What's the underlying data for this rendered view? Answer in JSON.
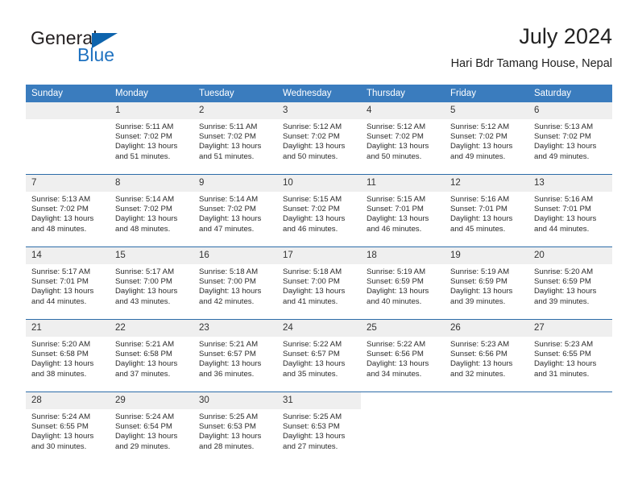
{
  "logo": {
    "word_one": "General",
    "word_two": "Blue",
    "icon": "triangle-logo-icon"
  },
  "header": {
    "title": "July 2024",
    "subtitle": "Hari Bdr Tamang House, Nepal"
  },
  "calendar": {
    "weekdays": [
      "Sunday",
      "Monday",
      "Tuesday",
      "Wednesday",
      "Thursday",
      "Friday",
      "Saturday"
    ],
    "header_bg": "#3a7cbe",
    "daynum_bg": "#efefef",
    "row_divider": "#2d6ca8",
    "weeks": [
      [
        {
          "day": "",
          "lines": []
        },
        {
          "day": "1",
          "lines": [
            "Sunrise: 5:11 AM",
            "Sunset: 7:02 PM",
            "Daylight: 13 hours",
            "and 51 minutes."
          ]
        },
        {
          "day": "2",
          "lines": [
            "Sunrise: 5:11 AM",
            "Sunset: 7:02 PM",
            "Daylight: 13 hours",
            "and 51 minutes."
          ]
        },
        {
          "day": "3",
          "lines": [
            "Sunrise: 5:12 AM",
            "Sunset: 7:02 PM",
            "Daylight: 13 hours",
            "and 50 minutes."
          ]
        },
        {
          "day": "4",
          "lines": [
            "Sunrise: 5:12 AM",
            "Sunset: 7:02 PM",
            "Daylight: 13 hours",
            "and 50 minutes."
          ]
        },
        {
          "day": "5",
          "lines": [
            "Sunrise: 5:12 AM",
            "Sunset: 7:02 PM",
            "Daylight: 13 hours",
            "and 49 minutes."
          ]
        },
        {
          "day": "6",
          "lines": [
            "Sunrise: 5:13 AM",
            "Sunset: 7:02 PM",
            "Daylight: 13 hours",
            "and 49 minutes."
          ]
        }
      ],
      [
        {
          "day": "7",
          "lines": [
            "Sunrise: 5:13 AM",
            "Sunset: 7:02 PM",
            "Daylight: 13 hours",
            "and 48 minutes."
          ]
        },
        {
          "day": "8",
          "lines": [
            "Sunrise: 5:14 AM",
            "Sunset: 7:02 PM",
            "Daylight: 13 hours",
            "and 48 minutes."
          ]
        },
        {
          "day": "9",
          "lines": [
            "Sunrise: 5:14 AM",
            "Sunset: 7:02 PM",
            "Daylight: 13 hours",
            "and 47 minutes."
          ]
        },
        {
          "day": "10",
          "lines": [
            "Sunrise: 5:15 AM",
            "Sunset: 7:02 PM",
            "Daylight: 13 hours",
            "and 46 minutes."
          ]
        },
        {
          "day": "11",
          "lines": [
            "Sunrise: 5:15 AM",
            "Sunset: 7:01 PM",
            "Daylight: 13 hours",
            "and 46 minutes."
          ]
        },
        {
          "day": "12",
          "lines": [
            "Sunrise: 5:16 AM",
            "Sunset: 7:01 PM",
            "Daylight: 13 hours",
            "and 45 minutes."
          ]
        },
        {
          "day": "13",
          "lines": [
            "Sunrise: 5:16 AM",
            "Sunset: 7:01 PM",
            "Daylight: 13 hours",
            "and 44 minutes."
          ]
        }
      ],
      [
        {
          "day": "14",
          "lines": [
            "Sunrise: 5:17 AM",
            "Sunset: 7:01 PM",
            "Daylight: 13 hours",
            "and 44 minutes."
          ]
        },
        {
          "day": "15",
          "lines": [
            "Sunrise: 5:17 AM",
            "Sunset: 7:00 PM",
            "Daylight: 13 hours",
            "and 43 minutes."
          ]
        },
        {
          "day": "16",
          "lines": [
            "Sunrise: 5:18 AM",
            "Sunset: 7:00 PM",
            "Daylight: 13 hours",
            "and 42 minutes."
          ]
        },
        {
          "day": "17",
          "lines": [
            "Sunrise: 5:18 AM",
            "Sunset: 7:00 PM",
            "Daylight: 13 hours",
            "and 41 minutes."
          ]
        },
        {
          "day": "18",
          "lines": [
            "Sunrise: 5:19 AM",
            "Sunset: 6:59 PM",
            "Daylight: 13 hours",
            "and 40 minutes."
          ]
        },
        {
          "day": "19",
          "lines": [
            "Sunrise: 5:19 AM",
            "Sunset: 6:59 PM",
            "Daylight: 13 hours",
            "and 39 minutes."
          ]
        },
        {
          "day": "20",
          "lines": [
            "Sunrise: 5:20 AM",
            "Sunset: 6:59 PM",
            "Daylight: 13 hours",
            "and 39 minutes."
          ]
        }
      ],
      [
        {
          "day": "21",
          "lines": [
            "Sunrise: 5:20 AM",
            "Sunset: 6:58 PM",
            "Daylight: 13 hours",
            "and 38 minutes."
          ]
        },
        {
          "day": "22",
          "lines": [
            "Sunrise: 5:21 AM",
            "Sunset: 6:58 PM",
            "Daylight: 13 hours",
            "and 37 minutes."
          ]
        },
        {
          "day": "23",
          "lines": [
            "Sunrise: 5:21 AM",
            "Sunset: 6:57 PM",
            "Daylight: 13 hours",
            "and 36 minutes."
          ]
        },
        {
          "day": "24",
          "lines": [
            "Sunrise: 5:22 AM",
            "Sunset: 6:57 PM",
            "Daylight: 13 hours",
            "and 35 minutes."
          ]
        },
        {
          "day": "25",
          "lines": [
            "Sunrise: 5:22 AM",
            "Sunset: 6:56 PM",
            "Daylight: 13 hours",
            "and 34 minutes."
          ]
        },
        {
          "day": "26",
          "lines": [
            "Sunrise: 5:23 AM",
            "Sunset: 6:56 PM",
            "Daylight: 13 hours",
            "and 32 minutes."
          ]
        },
        {
          "day": "27",
          "lines": [
            "Sunrise: 5:23 AM",
            "Sunset: 6:55 PM",
            "Daylight: 13 hours",
            "and 31 minutes."
          ]
        }
      ],
      [
        {
          "day": "28",
          "lines": [
            "Sunrise: 5:24 AM",
            "Sunset: 6:55 PM",
            "Daylight: 13 hours",
            "and 30 minutes."
          ]
        },
        {
          "day": "29",
          "lines": [
            "Sunrise: 5:24 AM",
            "Sunset: 6:54 PM",
            "Daylight: 13 hours",
            "and 29 minutes."
          ]
        },
        {
          "day": "30",
          "lines": [
            "Sunrise: 5:25 AM",
            "Sunset: 6:53 PM",
            "Daylight: 13 hours",
            "and 28 minutes."
          ]
        },
        {
          "day": "31",
          "lines": [
            "Sunrise: 5:25 AM",
            "Sunset: 6:53 PM",
            "Daylight: 13 hours",
            "and 27 minutes."
          ]
        },
        {
          "day": "",
          "lines": [],
          "blank": true
        },
        {
          "day": "",
          "lines": [],
          "blank": true
        },
        {
          "day": "",
          "lines": [],
          "blank": true
        }
      ]
    ]
  }
}
